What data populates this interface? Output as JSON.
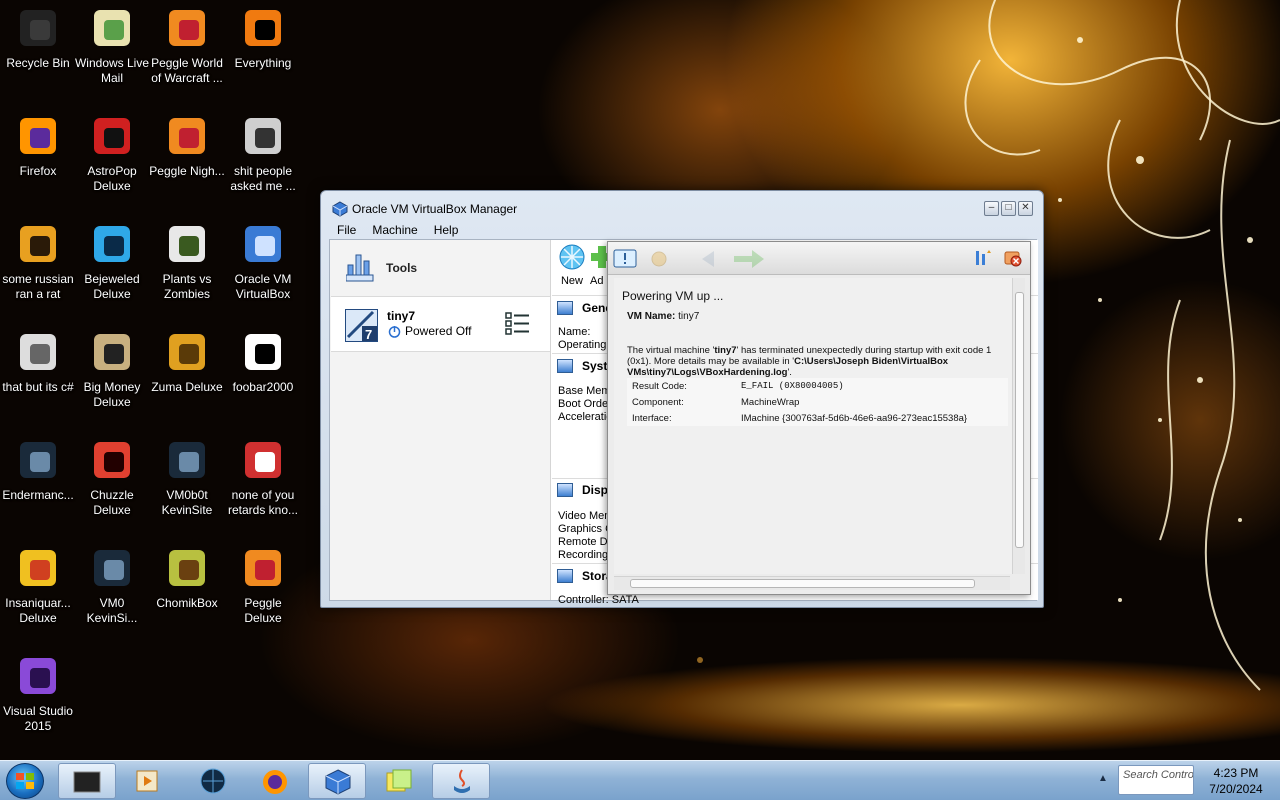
{
  "desktop": {
    "icons": [
      {
        "label": "Recycle Bin",
        "icon": "recycle-bin-icon"
      },
      {
        "label": "Windows Live Mail",
        "icon": "windows-live-mail-icon"
      },
      {
        "label": "Peggle World of Warcraft ...",
        "icon": "peggle-icon"
      },
      {
        "label": "Everything",
        "icon": "everything-search-icon"
      },
      {
        "label": "Firefox",
        "icon": "firefox-icon"
      },
      {
        "label": "AstroPop Deluxe",
        "icon": "astropop-icon"
      },
      {
        "label": "Peggle Nigh...",
        "icon": "peggle-icon"
      },
      {
        "label": "shit people asked me ...",
        "icon": "folder-icon"
      },
      {
        "label": "some russian ran a rat",
        "icon": "file-icon"
      },
      {
        "label": "Bejeweled Deluxe",
        "icon": "bejeweled-icon"
      },
      {
        "label": "Plants vs Zombies",
        "icon": "plants-vs-zombies-icon"
      },
      {
        "label": "Oracle VM VirtualBox",
        "icon": "virtualbox-icon"
      },
      {
        "label": "that but its c#",
        "icon": "shortcut-icon"
      },
      {
        "label": "Big Money Deluxe",
        "icon": "big-money-icon"
      },
      {
        "label": "Zuma Deluxe",
        "icon": "zuma-icon"
      },
      {
        "label": "foobar2000",
        "icon": "foobar2000-icon"
      },
      {
        "label": "Endermanc...",
        "icon": "video-file-icon"
      },
      {
        "label": "Chuzzle Deluxe",
        "icon": "chuzzle-icon"
      },
      {
        "label": "VM0b0t KevinSite",
        "icon": "video-file-icon"
      },
      {
        "label": "none of you retards kno...",
        "icon": "image-file-icon"
      },
      {
        "label": "Insaniquar... Deluxe",
        "icon": "insaniquarium-icon"
      },
      {
        "label": "VM0 KevinSi...",
        "icon": "video-file-icon"
      },
      {
        "label": "ChomikBox",
        "icon": "chomikbox-icon"
      },
      {
        "label": "Peggle Deluxe",
        "icon": "peggle-icon"
      },
      {
        "label": "Visual Studio 2015",
        "icon": "visual-studio-icon"
      }
    ]
  },
  "window": {
    "title": "Oracle VM VirtualBox Manager",
    "menu": [
      "File",
      "Machine",
      "Help"
    ],
    "tools_label": "Tools",
    "vm": {
      "name": "tiny7",
      "state": "Powered Off",
      "version_badge": "7"
    },
    "toolbar": {
      "new_label": "New",
      "add_label": "Ad"
    },
    "sections": {
      "general": {
        "title": "General",
        "lines": [
          "Name:",
          "Operating"
        ]
      },
      "system": {
        "title": "System",
        "lines": [
          "Base Memo",
          "Boot Order",
          "Acceleration"
        ]
      },
      "display": {
        "title": "Display",
        "lines": [
          "Video Mem",
          "Graphics C",
          "Remote De",
          "Recording"
        ]
      },
      "storage": {
        "title": "Storage",
        "lines": [
          "Controller: SATA"
        ]
      }
    }
  },
  "log_panel": {
    "status": "Powering VM up ...",
    "vm_name_label": "VM Name:",
    "vm_name_value": "tiny7",
    "error_prefix": "The virtual machine '",
    "error_vm": "tiny7",
    "error_mid": "' has terminated unexpectedly during startup with exit code 1 (0x1). More details may be available in '",
    "error_path": "C:\\Users\\Joseph Biden\\VirtualBox VMs\\tiny7\\Logs\\VBoxHardening.log",
    "error_suffix": "'.",
    "details": [
      {
        "key": "Result Code:",
        "value": "E_FAIL (0X80004005)"
      },
      {
        "key": "Component:",
        "value": "MachineWrap"
      },
      {
        "key": "Interface:",
        "value": "IMachine {300763af-5d6b-46e6-aa96-273eac15538a}"
      }
    ]
  },
  "taskbar": {
    "search_text": "Search Contro",
    "time": "4:23 PM",
    "date": "7/20/2024"
  },
  "colors": {
    "taskbar": "#8fb2d6",
    "window_frame": "#dfe8f3",
    "accent": "#2f5d94"
  }
}
